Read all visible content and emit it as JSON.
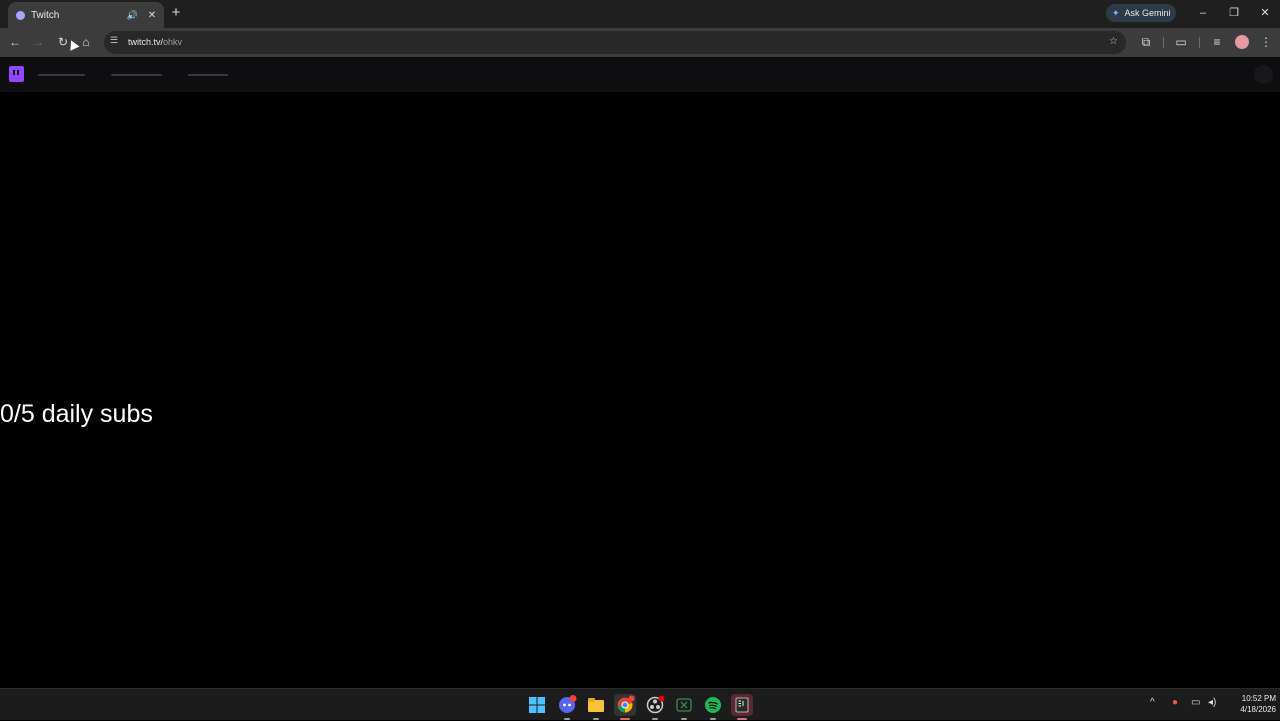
{
  "browser": {
    "tab": {
      "title": "Twitch"
    },
    "gemini_label": "Ask Gemini",
    "url": {
      "host": "twitch.tv/",
      "path": "ohkv"
    }
  },
  "page": {
    "overlay_text": "0/5 daily subs"
  },
  "taskbar": {
    "clock_time": "10:52 PM",
    "clock_date": "4/18/2026",
    "apps": [
      "windows-start",
      "discord",
      "file-explorer",
      "chrome",
      "obs",
      "xbox",
      "spotify",
      "epic-games"
    ]
  },
  "colors": {
    "twitch_brand": "#9147ff",
    "page_bg": "#000000"
  }
}
